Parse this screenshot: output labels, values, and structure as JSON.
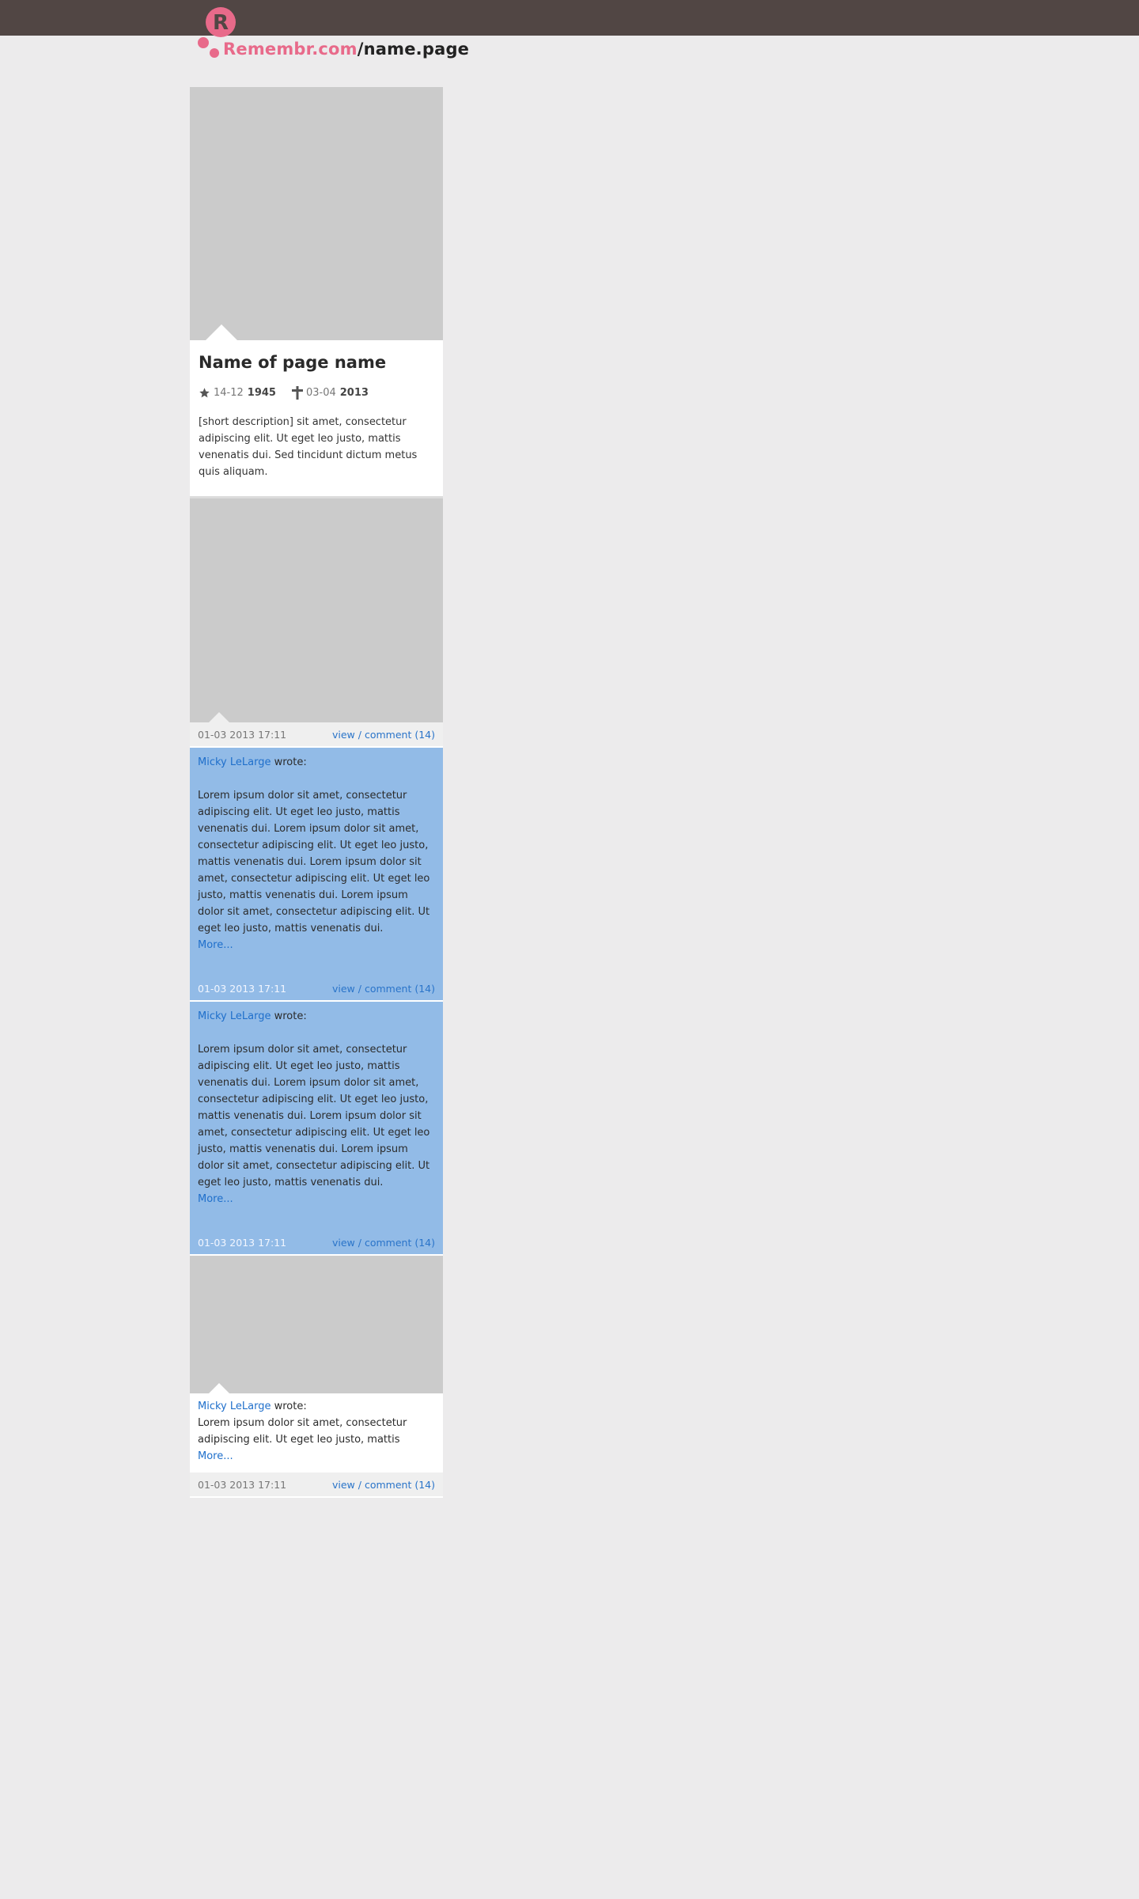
{
  "header": {
    "brand": "Remembr.com",
    "slash": "/",
    "page_name": "name.page",
    "logo_icon": "remembr-logo-icon",
    "bar_color": "#514644",
    "brand_color": "#e86a8a"
  },
  "profile": {
    "name": "Name of page name",
    "birth": {
      "icon": "star-icon",
      "day_month": "14-12",
      "year": "1945"
    },
    "death": {
      "icon": "cross-icon",
      "day_month": "03-04",
      "year": "2013"
    },
    "description": "[short description] sit amet, consectetur adipiscing elit. Ut eget leo justo, mattis venenatis dui. Sed tincidunt dictum metus quis aliquam."
  },
  "posts": [
    {
      "type": "image",
      "date": "01-03 2013 17:11",
      "view_label": "view",
      "sep": "/",
      "comment_label": "comment (14)"
    },
    {
      "type": "text",
      "author": "Micky LeLarge",
      "wrote": " wrote:",
      "body": "Lorem ipsum dolor sit amet, consectetur adipiscing elit. Ut eget leo justo, mattis venenatis dui.  Lorem ipsum dolor sit amet, consectetur adipiscing elit. Ut eget leo justo, mattis venenatis dui. Lorem ipsum dolor sit amet, consectetur adipiscing elit. Ut eget leo justo, mattis venenatis dui. Lorem ipsum dolor sit amet, consectetur adipiscing elit. Ut eget leo justo, mattis venenatis dui.",
      "more": "More...",
      "date": "01-03 2013 17:11",
      "view_label": "view",
      "sep": "/",
      "comment_label": "comment (14)"
    },
    {
      "type": "text",
      "author": "Micky LeLarge",
      "wrote": " wrote:",
      "body": "Lorem ipsum dolor sit amet, consectetur adipiscing elit. Ut eget leo justo, mattis venenatis dui.  Lorem ipsum dolor sit amet, consectetur adipiscing elit. Ut eget leo justo, mattis venenatis dui. Lorem ipsum dolor sit amet, consectetur adipiscing elit. Ut eget leo justo, mattis venenatis dui. Lorem ipsum dolor sit amet, consectetur adipiscing elit. Ut eget leo justo, mattis venenatis dui.",
      "more": "More...",
      "date": "01-03 2013 17:11",
      "view_label": "view",
      "sep": "/",
      "comment_label": "comment (14)"
    },
    {
      "type": "image-text",
      "author": "Micky LeLarge",
      "wrote": " wrote:",
      "body": "Lorem ipsum dolor sit amet, consectetur adipiscing elit. Ut eget leo justo, mattis",
      "more": "More...",
      "date": "01-03 2013 17:11",
      "view_label": "view",
      "sep": "/",
      "comment_label": "comment (14)"
    }
  ]
}
